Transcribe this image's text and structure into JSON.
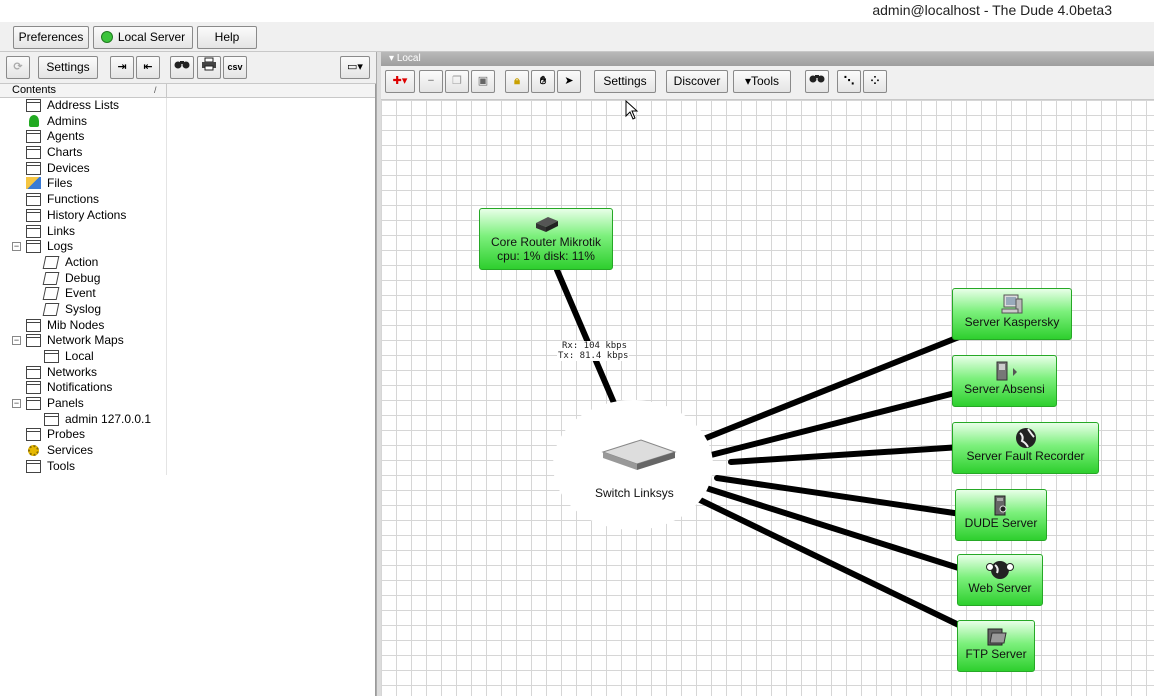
{
  "window": {
    "title": "admin@localhost - The Dude 4.0beta3"
  },
  "topbar": {
    "preferences": "Preferences",
    "server": "Local Server",
    "help": "Help"
  },
  "left_toolbar": {
    "settings": "Settings",
    "csv": "csv"
  },
  "tree": {
    "header": "Contents",
    "items": [
      {
        "label": "Address Lists",
        "indent": 0
      },
      {
        "label": "Admins",
        "indent": 0
      },
      {
        "label": "Agents",
        "indent": 0
      },
      {
        "label": "Charts",
        "indent": 0
      },
      {
        "label": "Devices",
        "indent": 0
      },
      {
        "label": "Files",
        "indent": 0
      },
      {
        "label": "Functions",
        "indent": 0
      },
      {
        "label": "History Actions",
        "indent": 0
      },
      {
        "label": "Links",
        "indent": 0
      },
      {
        "label": "Logs",
        "indent": 0,
        "expanded": true
      },
      {
        "label": "Action",
        "indent": 1
      },
      {
        "label": "Debug",
        "indent": 1
      },
      {
        "label": "Event",
        "indent": 1
      },
      {
        "label": "Syslog",
        "indent": 1
      },
      {
        "label": "Mib Nodes",
        "indent": 0
      },
      {
        "label": "Network Maps",
        "indent": 0,
        "expanded": true
      },
      {
        "label": "Local",
        "indent": 1
      },
      {
        "label": "Networks",
        "indent": 0
      },
      {
        "label": "Notifications",
        "indent": 0
      },
      {
        "label": "Panels",
        "indent": 0,
        "expanded": true
      },
      {
        "label": "admin 127.0.0.1",
        "indent": 1
      },
      {
        "label": "Probes",
        "indent": 0
      },
      {
        "label": "Services",
        "indent": 0
      },
      {
        "label": "Tools",
        "indent": 0
      }
    ]
  },
  "map": {
    "title": "Local",
    "toolbar": {
      "settings": "Settings",
      "discover": "Discover",
      "tools": "Tools"
    },
    "nodes": {
      "core_router_name": "Core Router Mikrotik",
      "core_router_status": "cpu: 1% disk: 11%",
      "switch": "Switch Linksys",
      "kaspersky": "Server Kaspersky",
      "absensi": "Server Absensi",
      "fault": "Server Fault Recorder",
      "dude": "DUDE Server",
      "web": "Web Server",
      "ftp": "FTP Server"
    },
    "link": {
      "rx": "Rx: 104 kbps",
      "tx": "Tx: 81.4 kbps"
    }
  },
  "colors": {
    "node_green": "#2ecf2e",
    "link": "#000000",
    "grid": "#d6d6d6"
  }
}
